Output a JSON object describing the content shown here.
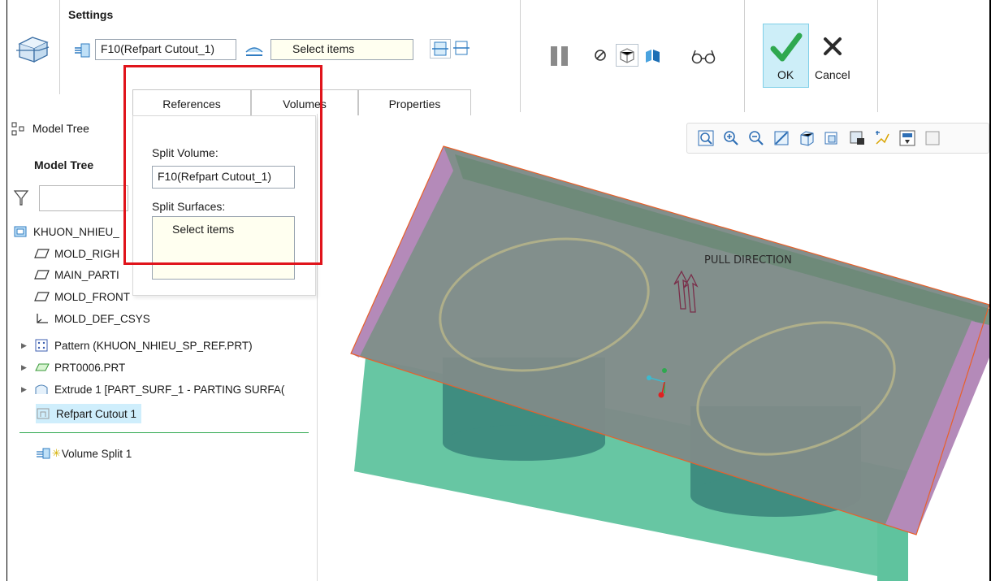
{
  "ribbon": {
    "settings_label": "Settings",
    "volume_field": "F10(Refpart Cutout_1)",
    "surfaces_field": "Select items",
    "ok_label": "OK",
    "cancel_label": "Cancel"
  },
  "tabs": [
    {
      "label": "References",
      "active": true
    },
    {
      "label": "Volumes",
      "active": false
    },
    {
      "label": "Properties",
      "active": false
    }
  ],
  "references_panel": {
    "split_volume_label": "Split Volume:",
    "split_volume_value": "F10(Refpart Cutout_1)",
    "split_surfaces_label": "Split Surfaces:",
    "split_surfaces_value": "Select items"
  },
  "model_tree": {
    "tab_label": "Model Tree",
    "title": "Model Tree",
    "items": [
      {
        "label": "KHUON_NHIEU_",
        "icon": "assembly-icon"
      },
      {
        "label": "MOLD_RIGH",
        "icon": "datum-plane-icon"
      },
      {
        "label": "MAIN_PARTI",
        "icon": "datum-plane-icon"
      },
      {
        "label": "MOLD_FRONT",
        "icon": "datum-plane-icon"
      },
      {
        "label": "MOLD_DEF_CSYS",
        "icon": "csys-icon"
      },
      {
        "label": "Pattern (KHUON_NHIEU_SP_REF.PRT)",
        "icon": "pattern-icon"
      },
      {
        "label": "PRT0006.PRT",
        "icon": "part-icon"
      },
      {
        "label": "Extrude 1 [PART_SURF_1 - PARTING SURFA(",
        "icon": "surface-icon"
      },
      {
        "label": "Refpart Cutout 1",
        "icon": "cutout-icon"
      },
      {
        "label": "Volume Split 1",
        "icon": "volume-split-icon"
      }
    ]
  },
  "graphics": {
    "pull_direction_label": "PULL DIRECTION"
  },
  "colors": {
    "highlight_box": "#e0141b",
    "ok_button_bg": "#cdeef8",
    "mold_green": "#5fc39e",
    "slab_gray": "#7e8b88",
    "slab_edge_purple": "#b48ab9"
  }
}
